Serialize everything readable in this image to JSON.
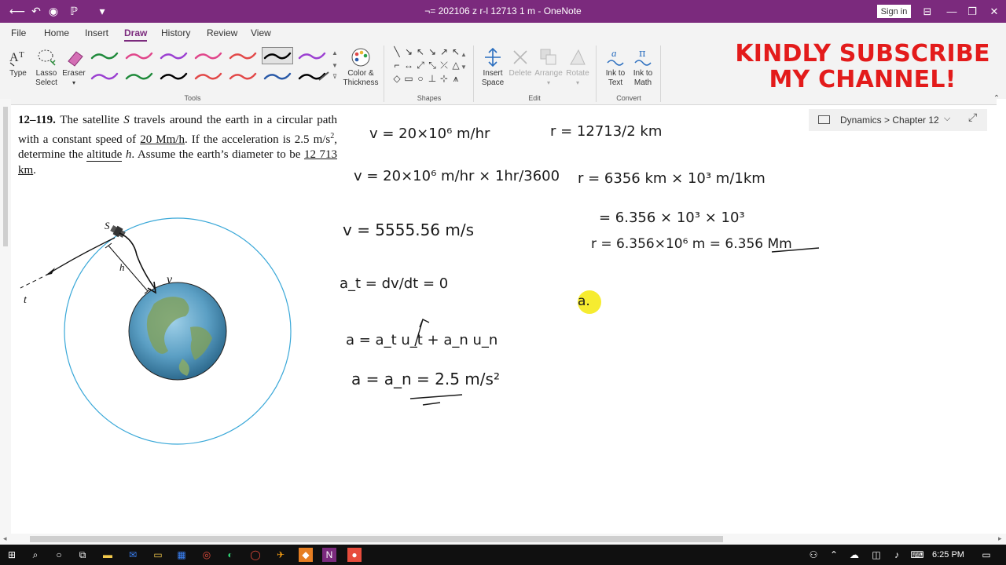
{
  "window": {
    "title": "¬= 202106 z r-l 12713 1 m  -  OneNote",
    "sign_in": "Sign in"
  },
  "menu": {
    "tabs": [
      "File",
      "Home",
      "Insert",
      "Draw",
      "History",
      "Review",
      "View"
    ],
    "active": "Draw"
  },
  "ribbon": {
    "tools": {
      "type_label": "Type",
      "lasso_label": "Lasso Select",
      "eraser_label": "Eraser",
      "color_label": "Color & Thickness",
      "group_label": "Tools",
      "pens_row1": [
        "#1f8a3b",
        "#e0458a",
        "#9b3fd1",
        "#e0458a",
        "#e24848",
        "#000000",
        "#9b3fd1"
      ],
      "pens_row2": [
        "#9b3fd1",
        "#1f8a3b",
        "#000000",
        "#e24848",
        "#e24848",
        "#2a5aa8",
        "#000000"
      ]
    },
    "shapes": {
      "group_label": "Shapes"
    },
    "edit": {
      "insert_space": "Insert Space",
      "delete": "Delete",
      "arrange": "Arrange",
      "rotate": "Rotate",
      "group_label": "Edit"
    },
    "convert": {
      "ink_to_text": "Ink to Text",
      "ink_to_math": "Ink to Math",
      "group_label": "Convert"
    }
  },
  "overlay": {
    "line1": "KINDLY SUBSCRIBE",
    "line2": "MY CHANNEL!",
    "color": "#e31b1b"
  },
  "breadcrumb": {
    "text": "Dynamics > Chapter 12"
  },
  "problem": {
    "number": "12–119.",
    "text_a": "The satellite",
    "sym_s": "S",
    "text_b": "travels around the earth in a circular path with a constant speed of",
    "speed": "20 Mm/h",
    "text_c": ". If the acceleration is 2.5 m/s",
    "sup": "2",
    "text_d": ", determine the",
    "altitude": "altitude",
    "sym_h": "h",
    "text_e": ". Assume the earth’s diameter to be",
    "diameter": "12 713 km",
    "text_f": "."
  },
  "figure": {
    "label_s": "S",
    "label_h": "h",
    "label_v": "v",
    "label_t": "t",
    "orbit_color": "#3aa8d8"
  },
  "notes": {
    "v1": "v = 20×10⁶ m/hr",
    "v2": "v = 20×10⁶ m/hr × 1hr/3600",
    "v3": "v = 5555.56 m/s",
    "at": "a_t = dv/dt = 0",
    "avec": "a = a_t u_t + a_n u_n",
    "an": "a = a_n = 2.5 m/s²",
    "r1": "r = 12713/2 km",
    "r2": "r = 6356 km × 10³ m/1km",
    "r3": "= 6.356 × 10³ × 10³",
    "r4": "r = 6.356×10⁶ m = 6.356 Mm",
    "a_start": "a."
  },
  "taskbar": {
    "time": "6:25 PM"
  }
}
